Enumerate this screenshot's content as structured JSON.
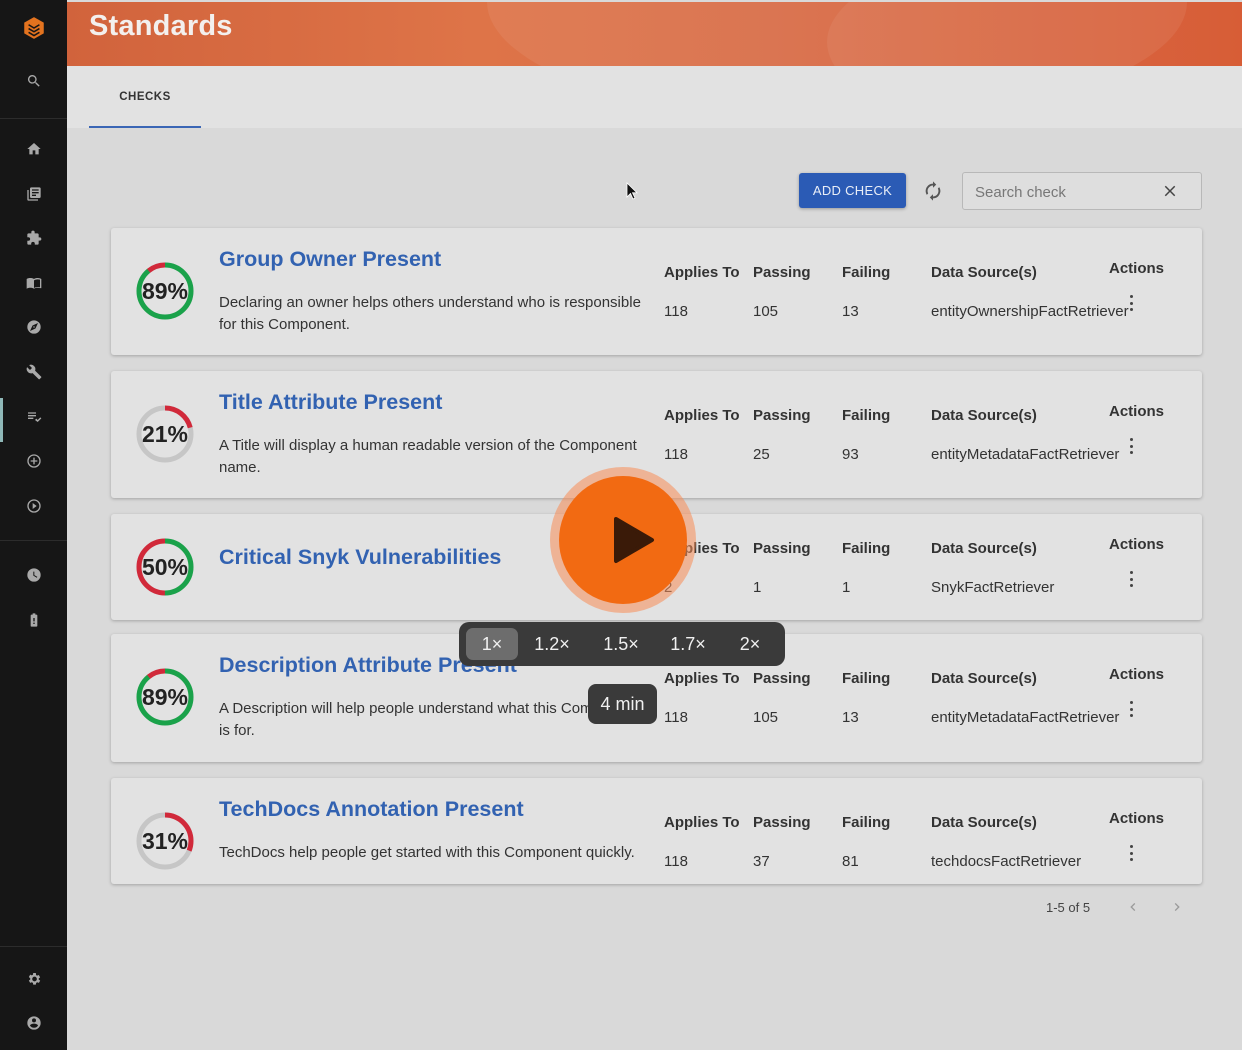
{
  "header": {
    "title": "Standards"
  },
  "tabs": [
    {
      "label": "CHECKS"
    }
  ],
  "toolbar": {
    "add_check_label": "ADD CHECK",
    "search_placeholder": "Search check"
  },
  "checks": [
    {
      "percent": 89,
      "percent_label": "89%",
      "title": "Group Owner Present",
      "description": "Declaring an owner helps others understand who is responsible for this Component.",
      "applies_to": "118",
      "passing": "105",
      "failing": "13",
      "data_source": "entityOwnershipFactRetriever"
    },
    {
      "percent": 21,
      "percent_label": "21%",
      "title": "Title Attribute Present",
      "description": "A Title will display a human readable version of the Component name.",
      "applies_to": "118",
      "passing": "25",
      "failing": "93",
      "data_source": "entityMetadataFactRetriever"
    },
    {
      "percent": 50,
      "percent_label": "50%",
      "title": "Critical Snyk Vulnerabilities",
      "description": "",
      "applies_to": "2",
      "passing": "1",
      "failing": "1",
      "data_source": "SnykFactRetriever"
    },
    {
      "percent": 89,
      "percent_label": "89%",
      "title": "Description Attribute Present",
      "description": "A Description will help people understand what this Component is for.",
      "applies_to": "118",
      "passing": "105",
      "failing": "13",
      "data_source": "entityMetadataFactRetriever"
    },
    {
      "percent": 31,
      "percent_label": "31%",
      "title": "TechDocs Annotation Present",
      "description": "TechDocs help people get started with this Component quickly.",
      "applies_to": "118",
      "passing": "37",
      "failing": "81",
      "data_source": "techdocsFactRetriever"
    }
  ],
  "columns": {
    "applies_to": "Applies To",
    "passing": "Passing",
    "failing": "Failing",
    "data_source": "Data Source(s)",
    "actions": "Actions"
  },
  "pagination": {
    "range": "1-5 of 5"
  },
  "video": {
    "speeds": [
      "1×",
      "1.2×",
      "1.5×",
      "1.7×",
      "2×"
    ],
    "selected_speed": "1×",
    "duration": "4 min"
  },
  "colors": {
    "pass": "#1aa24a",
    "fail": "#d1293a",
    "track": "#c6c6c6",
    "link": "#3262b1",
    "primary": "#2b5bb5",
    "play": "#f26a12"
  },
  "sidebar_icons": [
    "logo-icon",
    "search-icon",
    "home-icon",
    "catalog-icon",
    "puzzle-icon",
    "docs-icon",
    "compass-icon",
    "wrench-icon",
    "checklist-icon",
    "add-circle-icon",
    "play-circle-icon",
    "clock-icon",
    "battery-icon",
    "settings-icon",
    "account-icon"
  ]
}
